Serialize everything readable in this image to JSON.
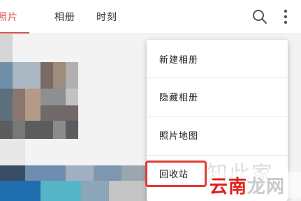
{
  "tabs": [
    {
      "label": "照片",
      "active": true
    },
    {
      "label": "相册",
      "active": false
    },
    {
      "label": "时刻",
      "active": false
    }
  ],
  "toolbar": {
    "search_icon": "search-icon",
    "more_icon": "more-vert-icon"
  },
  "menu": {
    "items": [
      {
        "label": "新建相册"
      },
      {
        "label": "隐藏相册"
      },
      {
        "label": "照片地图"
      },
      {
        "label": "回收站"
      }
    ]
  },
  "watermark": {
    "top_text": "知此家",
    "red_text": "云南",
    "gray_text": "龙网"
  },
  "colors": {
    "accent": "#d9534f",
    "highlight": "#e23a36"
  }
}
